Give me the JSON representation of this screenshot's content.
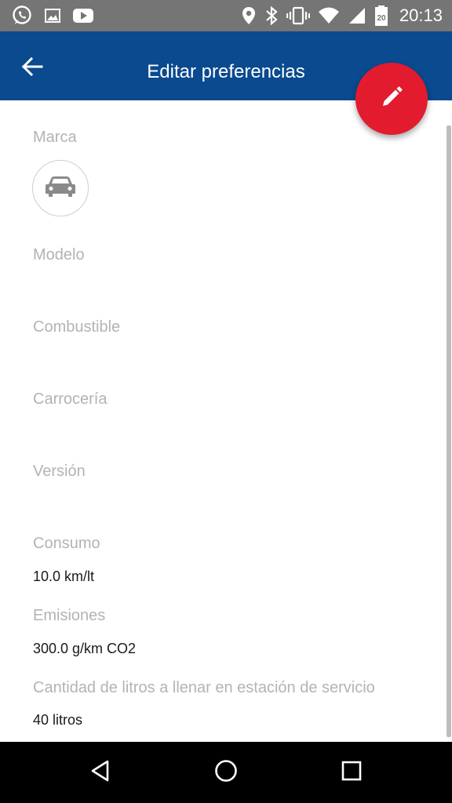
{
  "status_bar": {
    "time": "20:13",
    "left_icons": [
      "whatsapp-icon",
      "gallery-icon",
      "youtube-icon"
    ],
    "right_icons": [
      "location-icon",
      "bluetooth-icon",
      "vibrate-icon",
      "wifi-icon",
      "signal-icon",
      "battery-icon"
    ],
    "battery_level": "20"
  },
  "app_bar": {
    "title": "Editar preferencias",
    "back_icon": "arrow-back-icon",
    "fab_icon": "pencil-icon",
    "color": "#0a4a8f",
    "fab_color": "#e31b2e"
  },
  "form": {
    "marca_label": "Marca",
    "marca_icon": "car-icon",
    "modelo_label": "Modelo",
    "combustible_label": "Combustible",
    "carroceria_label": "Carrocería",
    "version_label": "Versión",
    "consumo_label": "Consumo",
    "consumo_value": "10.0 km/lt",
    "emisiones_label": "Emisiones",
    "emisiones_value": "300.0 g/km CO2",
    "litros_label": "Cantidad de litros a llenar en estación de servicio",
    "litros_value": "40 litros"
  },
  "nav_bar": {
    "buttons": [
      "back-triangle-icon",
      "home-circle-icon",
      "recents-square-icon"
    ]
  }
}
